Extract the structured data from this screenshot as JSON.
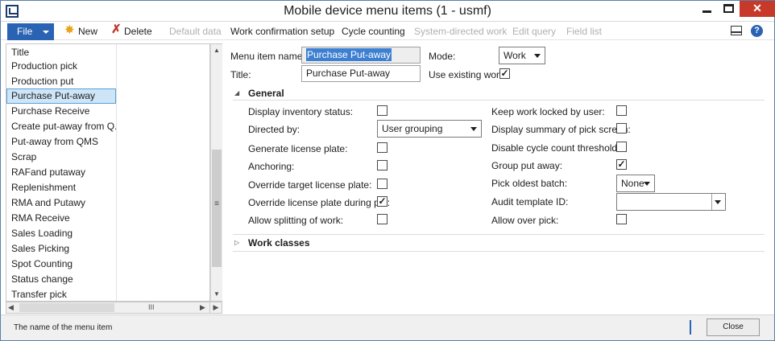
{
  "window": {
    "title": "Mobile device menu items (1 - usmf)",
    "controls": {
      "minimize": "minimize-icon",
      "maximize": "maximize-icon",
      "close": "✕"
    }
  },
  "toolbar": {
    "file_label": "File",
    "new_label": "New",
    "delete_label": "Delete",
    "default_data_label": "Default data",
    "work_confirmation_label": "Work confirmation setup",
    "cycle_counting_label": "Cycle counting",
    "system_directed_work_label": "System-directed work",
    "edit_query_label": "Edit query",
    "field_list_label": "Field list",
    "help_label": "?",
    "accent_color": "#2a63b3"
  },
  "list": {
    "header": "Title",
    "items": [
      "Production pick",
      "Production put",
      "Purchase Put-away",
      "Purchase Receive",
      "Create put-away from Q...",
      "Put-away from QMS",
      "Scrap",
      "RAFand putaway",
      "Replenishment",
      "RMA and Putawy",
      "RMA Receive",
      "Sales Loading",
      "Sales Picking",
      "Spot Counting",
      "Status change",
      "Transfer pick"
    ],
    "selected_index": 2,
    "scroll_grip": "≡",
    "hscroll_grip": "III"
  },
  "form": {
    "menu_item_name_label": "Menu item name:",
    "menu_item_name_value": "Purchase Put-away",
    "title_label": "Title:",
    "title_value": "Purchase Put-away",
    "mode_label": "Mode:",
    "mode_value": "Work",
    "use_existing_work_label": "Use existing work:",
    "use_existing_work_checked": true
  },
  "general": {
    "header": "General",
    "display_inventory_status_label": "Display inventory status:",
    "display_inventory_status_checked": false,
    "directed_by_label": "Directed by:",
    "directed_by_value": "User grouping",
    "generate_license_plate_label": "Generate license plate:",
    "generate_license_plate_checked": false,
    "anchoring_label": "Anchoring:",
    "anchoring_checked": false,
    "override_target_label": "Override target license plate:",
    "override_target_checked": false,
    "override_during_put_label": "Override license plate during put:",
    "override_during_put_checked": true,
    "allow_splitting_label": "Allow splitting of work:",
    "allow_splitting_checked": false,
    "keep_work_locked_label": "Keep work locked by user:",
    "keep_work_locked_checked": false,
    "display_summary_label": "Display summary of pick screen:",
    "display_summary_checked": false,
    "disable_cycle_count_label": "Disable cycle count thresholds:",
    "disable_cycle_count_checked": false,
    "group_put_away_label": "Group put away:",
    "group_put_away_checked": true,
    "pick_oldest_batch_label": "Pick oldest batch:",
    "pick_oldest_batch_value": "None",
    "audit_template_label": "Audit template ID:",
    "audit_template_value": "",
    "allow_over_pick_label": "Allow over pick:",
    "allow_over_pick_checked": false
  },
  "work_classes": {
    "header": "Work classes"
  },
  "status": {
    "text": "The name of the menu item",
    "close_label": "Close"
  }
}
